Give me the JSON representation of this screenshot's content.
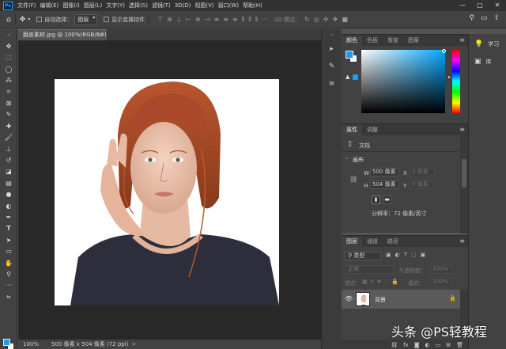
{
  "app": {
    "logo": "Ps",
    "menus": [
      "文件(F)",
      "编辑(E)",
      "图像(I)",
      "图层(L)",
      "文字(Y)",
      "选择(S)",
      "滤镜(T)",
      "3D(D)",
      "视图(V)",
      "窗口(W)",
      "帮助(H)"
    ],
    "window_controls": [
      "—",
      "□",
      "✕"
    ]
  },
  "options_bar": {
    "auto_select_label": "自动选择：",
    "auto_select_value": "图层",
    "show_transform_label": "显示变换控件",
    "mode_label": "3D 模式："
  },
  "document": {
    "tab_title": "磨皮素材.jpg @ 100%(RGB/8#)",
    "close_glyph": "×"
  },
  "status": {
    "zoom": "100%",
    "info": "500 像素 x 504 像素 (72 ppi)",
    "arrow": ">"
  },
  "color_panel": {
    "tabs": [
      "颜色",
      "色板",
      "渐变",
      "图案"
    ],
    "foreground_color": "#1a9cf0",
    "background_color": "#ffffff"
  },
  "properties_panel": {
    "tabs": [
      "属性",
      "调整"
    ],
    "doc_label": "文档",
    "section_title": "画布",
    "w_label": "W",
    "w_value": "500 像素",
    "x_label": "X",
    "x_placeholder": "0 像素",
    "h_label": "H",
    "h_value": "504 像素",
    "y_label": "Y",
    "y_placeholder": "0 像素",
    "resolution": "分辨率：72 像素/英寸"
  },
  "layers_panel": {
    "tabs": [
      "图层",
      "通道",
      "路径"
    ],
    "filter_kind": "类型",
    "blend_mode": "正常",
    "opacity_label": "不透明度：",
    "opacity_value": "100%",
    "lock_label": "锁定：",
    "fill_label": "填充：",
    "fill_value": "100%",
    "layers": [
      {
        "name": "背景",
        "visible": true,
        "locked": true
      }
    ],
    "footer_icons": [
      "link-icon",
      "fx-icon",
      "mask-icon",
      "adjustment-icon",
      "group-icon",
      "new-layer-icon",
      "trash-icon"
    ]
  },
  "learn_panel": {
    "items": [
      "学习",
      "库"
    ]
  },
  "watermark": "头条 @PS轻教程"
}
